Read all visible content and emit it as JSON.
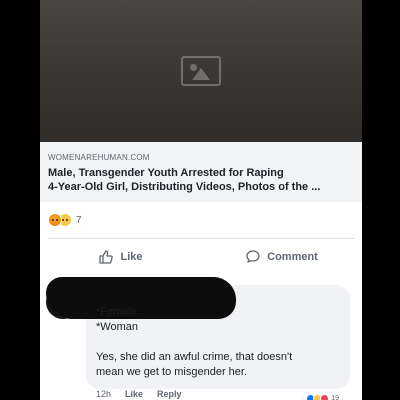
{
  "post": {
    "link_preview": {
      "domain": "WOMENAREHUMAN.COM",
      "title_line1": "Male, Transgender Youth Arrested for Raping",
      "title_line2": "4-Year-Old Girl, Distributing Videos, Photos of the ..."
    },
    "reactions": {
      "icons": [
        "angry-reaction",
        "sad-reaction"
      ],
      "count": "7"
    },
    "actions": {
      "like_label": "Like",
      "comment_label": "Comment"
    }
  },
  "comment": {
    "lines": [
      "*Female.",
      "*Woman",
      "Yes, she did an awful crime, that doesn't",
      "mean we get to misgender her."
    ],
    "reactions": {
      "icons": [
        "like-reaction",
        "haha-reaction",
        "love-reaction"
      ],
      "count": "19"
    },
    "meta": {
      "time": "12h",
      "like_label": "Like",
      "reply_label": "Reply"
    }
  },
  "colors": {
    "page_background": "#000000",
    "feed_background": "#e9ebee",
    "link_meta_background": "#f2f3f5",
    "comment_bubble": "#f0f2f5",
    "secondary_text": "#606770",
    "primary_text": "#1d2129"
  }
}
